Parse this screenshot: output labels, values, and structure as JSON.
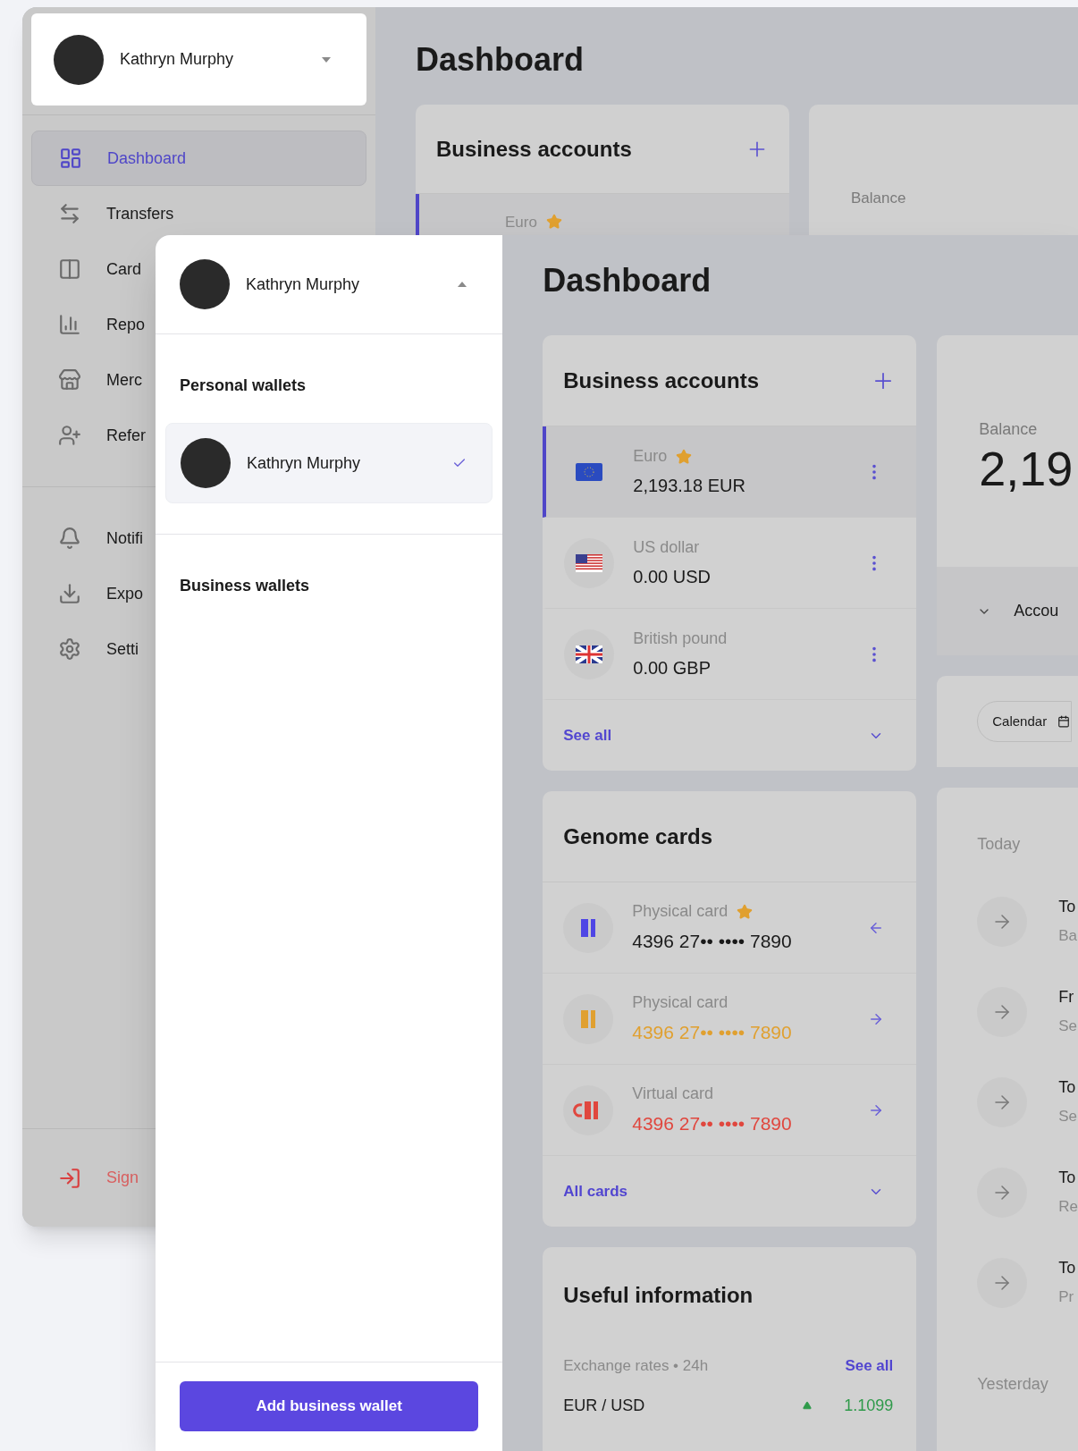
{
  "back_window": {
    "sidebar": {
      "user": {
        "name": "Kathryn Murphy",
        "expanded": false
      },
      "menu": [
        {
          "label": "Dashboard",
          "selected": true
        },
        {
          "label": "Transfers",
          "selected": false
        },
        {
          "label": "Card",
          "selected": false
        },
        {
          "label": "Repo",
          "selected": false
        },
        {
          "label": "Merc",
          "selected": false
        },
        {
          "label": "Refer",
          "selected": false
        },
        {
          "label": "Notifi",
          "selected": false
        },
        {
          "label": "Expo",
          "selected": false
        },
        {
          "label": "Setti",
          "selected": false
        }
      ],
      "sign_out": "Sign"
    },
    "main": {
      "title": "Dashboard",
      "business_accounts": {
        "title": "Business accounts",
        "first_row": {
          "name": "Euro",
          "starred": true
        }
      },
      "balance": {
        "label": "Balance"
      }
    }
  },
  "front_window": {
    "wallet_menu": {
      "user": {
        "name": "Kathryn Murphy",
        "expanded": true
      },
      "personal_wallets": {
        "title": "Personal wallets",
        "items": [
          {
            "name": "Kathryn Murphy",
            "selected": true
          }
        ]
      },
      "business_wallets": {
        "title": "Business wallets"
      },
      "add_button": "Add business wallet"
    },
    "main": {
      "title": "Dashboard",
      "business_accounts": {
        "title": "Business accounts",
        "rows": [
          {
            "kind": "eu",
            "name": "Euro",
            "amount": "2,193.18 EUR",
            "starred": true,
            "selected": true
          },
          {
            "kind": "us",
            "name": "US dollar",
            "amount": "0.00 USD",
            "starred": false,
            "selected": false
          },
          {
            "kind": "gb",
            "name": "British pound",
            "amount": "0.00 GBP",
            "starred": false,
            "selected": false
          }
        ],
        "footer_link": "See all"
      },
      "balance": {
        "label": "Balance",
        "amount": "2,19",
        "accounts_toggle": "Accou"
      },
      "filters": {
        "calendar": "Calendar"
      },
      "cards": {
        "title": "Genome cards",
        "rows": [
          {
            "kind": "physical",
            "name": "Physical card",
            "number": "4396 27•• •••• 7890",
            "starred": true,
            "color": "#4f46e5",
            "points_left": true
          },
          {
            "kind": "physical",
            "name": "Physical card",
            "number": "4396 27•• •••• 7890",
            "starred": false,
            "color": "#e0a030",
            "points_left": false
          },
          {
            "kind": "virtual",
            "name": "Virtual card",
            "number": "4396 27•• •••• 7890",
            "starred": false,
            "color": "#e0473e",
            "points_left": false
          }
        ],
        "footer_link": "All cards"
      },
      "useful_information": {
        "title": "Useful information",
        "exchange_label": "Exchange rates • 24h",
        "see_all": "See all",
        "rates": [
          {
            "pair": "EUR / USD",
            "rising": true,
            "value": "1.1099"
          }
        ]
      },
      "transactions": {
        "today": "Today",
        "rows": [
          {
            "title": "To",
            "subtitle": "Ba"
          },
          {
            "title": "Fr",
            "subtitle": "Se"
          },
          {
            "title": "To",
            "subtitle": "Se"
          },
          {
            "title": "To",
            "subtitle": "Re"
          },
          {
            "title": "To",
            "subtitle": "Pr"
          }
        ],
        "yesterday": "Yesterday"
      }
    }
  }
}
